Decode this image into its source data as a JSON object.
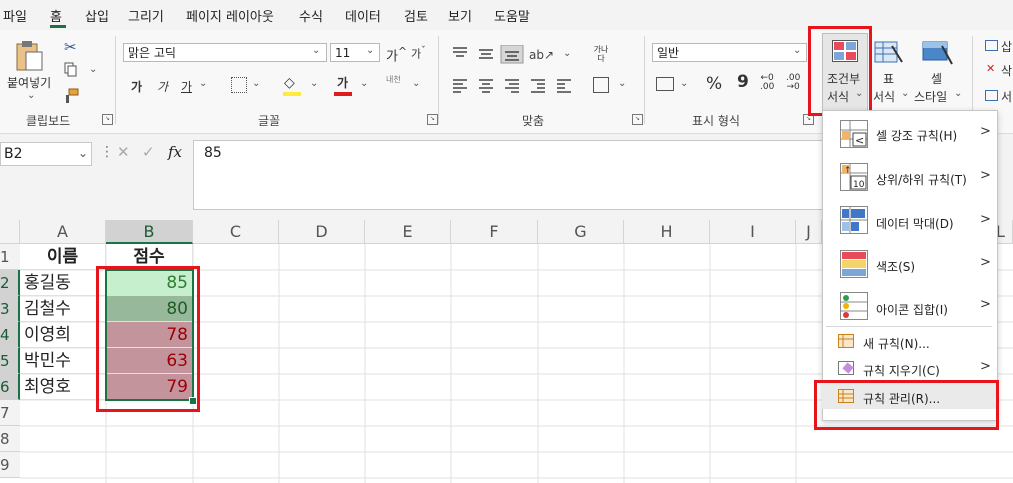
{
  "menu": {
    "tabs": [
      "파일",
      "홈",
      "삽입",
      "그리기",
      "페이지 레이아웃",
      "수식",
      "데이터",
      "검토",
      "보기",
      "도움말"
    ],
    "active": "홈"
  },
  "ribbon": {
    "clipboard": {
      "paste_label": "붙여넣기",
      "group_label": "클립보드"
    },
    "font": {
      "font_name": "맑은 고딕",
      "font_size": "11",
      "group_label": "글꼴",
      "bold": "가",
      "italic": "가",
      "underline": "가",
      "increase": "가",
      "decrease": "가",
      "phonetic": "내천",
      "color_letter": "가"
    },
    "align": {
      "group_label": "맞춤",
      "wrap": "가나다"
    },
    "number": {
      "format": "일반",
      "group_label": "표시 형식",
      "percent": "%",
      "comma": "9"
    },
    "styles": {
      "cond_format_line1": "조건부",
      "cond_format_line2": "서식",
      "table_line1": "표",
      "table_line2": "서식",
      "cell_style_line1": "셀",
      "cell_style_line2": "스타일"
    },
    "cells": {
      "insert": "삽",
      "delete": "삭",
      "format": "서"
    }
  },
  "formula_bar": {
    "name_box": "B2",
    "fx": "fx",
    "value": "85"
  },
  "sheet": {
    "columns": [
      "A",
      "B",
      "C",
      "D",
      "E",
      "F",
      "G",
      "H",
      "I",
      "J",
      "L"
    ],
    "rows": [
      "1",
      "2",
      "3",
      "4",
      "5",
      "6",
      "7",
      "8",
      "9"
    ],
    "header_row": {
      "a": "이름",
      "b": "점수"
    },
    "data": [
      {
        "name": "홍길동",
        "score": "85"
      },
      {
        "name": "김철수",
        "score": "80"
      },
      {
        "name": "이영희",
        "score": "78"
      },
      {
        "name": "박민수",
        "score": "63"
      },
      {
        "name": "최영호",
        "score": "79"
      }
    ]
  },
  "cf_menu": {
    "highlight_rules": "셀 강조 규칙(H)",
    "top_bottom": "상위/하위 규칙(T)",
    "data_bars": "데이터 막대(D)",
    "color_scales": "색조(S)",
    "icon_sets": "아이콘 집합(I)",
    "new_rule": "새 규칙(N)...",
    "clear_rules": "규칙 지우기(C)",
    "manage_rules": "규칙 관리(R)...",
    "top_icon_number": "10"
  },
  "colors": {
    "green_fill": "#c6efce",
    "green_dark_fill": "#98b89c",
    "red_fill": "#c4949c",
    "green_text": "#2e7d32",
    "red_text": "#9c0006",
    "highlight": "#e8141c"
  }
}
